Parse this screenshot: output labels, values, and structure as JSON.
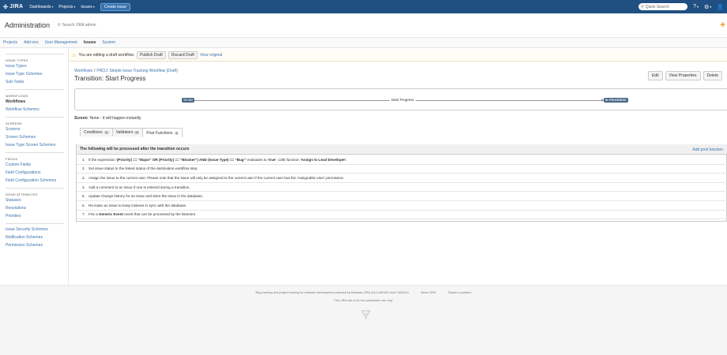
{
  "topnav": {
    "logo": "JIRA",
    "items": [
      {
        "label": "Dashboards",
        "caret": true
      },
      {
        "label": "Projects",
        "caret": true
      },
      {
        "label": "Issues",
        "caret": true
      }
    ],
    "create_button": "Create issue",
    "search_placeholder": "Quick Search"
  },
  "admin": {
    "title": "Administration",
    "search_placeholder": "Search JIRA admin"
  },
  "admin_tabs": [
    {
      "label": "Projects"
    },
    {
      "label": "Add-ons"
    },
    {
      "label": "User Management"
    },
    {
      "label": "Issues",
      "active": true
    },
    {
      "label": "System"
    }
  ],
  "sidebar": {
    "sections": [
      {
        "heading": "ISSUE TYPES",
        "items": [
          "Issue Types",
          "Issue Type Schemes",
          "Sub-Tasks"
        ]
      },
      {
        "heading": "WORKFLOWS",
        "items": [
          "Workflows",
          "Workflow Schemes"
        ]
      },
      {
        "heading": "SCREENS",
        "items": [
          "Screens",
          "Screen Schemes",
          "Issue Type Screen Schemes"
        ]
      },
      {
        "heading": "FIELDS",
        "items": [
          "Custom Fields",
          "Field Configurations",
          "Field Configuration Schemes"
        ]
      },
      {
        "heading": "ISSUE ATTRIBUTES",
        "items": [
          "Statuses",
          "Resolutions",
          "Priorities"
        ]
      },
      {
        "heading": "",
        "items": [
          "Issue Security Schemes",
          "Notification Schemes",
          "Permission Schemes"
        ]
      }
    ]
  },
  "draft_bar": {
    "message": "You are editing a draft workflow.",
    "publish_label": "Publish Draft",
    "discard_label": "Discard Draft",
    "view_original": "View original"
  },
  "breadcrumb": {
    "root": "Workflows",
    "separator": "/",
    "current": "PROJ: Simple Issue Tracking Workflow (Draft)"
  },
  "page_title": "Transition: Start Progress",
  "actions": {
    "edit": "Edit",
    "view_properties": "View Properties",
    "delete": "Delete"
  },
  "transition": {
    "from_status": "TO DO",
    "name": "Start Progress",
    "to_status": "IN PROGRESS",
    "status_color": "#4a6785"
  },
  "screen": {
    "label": "Screen",
    "value": ": None - it will happen instantly"
  },
  "tabs": [
    {
      "label": "Conditions",
      "count": "1"
    },
    {
      "label": "Validators",
      "count": "0"
    },
    {
      "label": "Post Functions",
      "count": "7",
      "active": true
    }
  ],
  "post_functions": {
    "header": "The following will be processed after the transition occurs",
    "add_label": "Add post function",
    "rows": [
      {
        "num": "1.",
        "parts": [
          {
            "t": "If the expression '",
            "b": false
          },
          {
            "t": "(Priority) == \"Major\" OR (Priority) == \"Blocker\") AND (Issue Type) == \"Bug\"",
            "b": true
          },
          {
            "t": "' evaluates to '",
            "b": false
          },
          {
            "t": "true",
            "b": true
          },
          {
            "t": "', calls function '",
            "b": false
          },
          {
            "t": "Assign to Lead Developer",
            "b": true
          },
          {
            "t": "'.",
            "b": false
          }
        ]
      },
      {
        "num": "2.",
        "parts": [
          {
            "t": "Set issue status to the linked status of the destination workflow step.",
            "b": false
          }
        ]
      },
      {
        "num": "3.",
        "parts": [
          {
            "t": "Assign the issue to the current user. Please note that the issue will only be assigned to the current user if the current user has the 'Assignable User' permission.",
            "b": false
          }
        ]
      },
      {
        "num": "4.",
        "parts": [
          {
            "t": "Add a comment to an issue if one is entered during a transition.",
            "b": false
          }
        ]
      },
      {
        "num": "5.",
        "parts": [
          {
            "t": "Update change history for an issue and store the issue in the database.",
            "b": false
          }
        ]
      },
      {
        "num": "6.",
        "parts": [
          {
            "t": "Re-index an issue to keep indexes in sync with the database.",
            "b": false
          }
        ]
      },
      {
        "num": "7.",
        "parts": [
          {
            "t": "Fire a ",
            "b": false
          },
          {
            "t": "Generic Event",
            "b": true
          },
          {
            "t": " event that can be processed by the listeners.",
            "b": false
          }
        ]
      }
    ]
  },
  "footer": {
    "links": [
      "Bug tracking and project tracking for software development powered by Atlassian JIRA (v6.1.6#6162-sha1:7af547c)",
      "About JIRA",
      "Report a problem"
    ],
    "note": "This JIRA site is for non-production use only."
  },
  "colors": {
    "header_bg": "#205081",
    "link": "#3b73af"
  }
}
